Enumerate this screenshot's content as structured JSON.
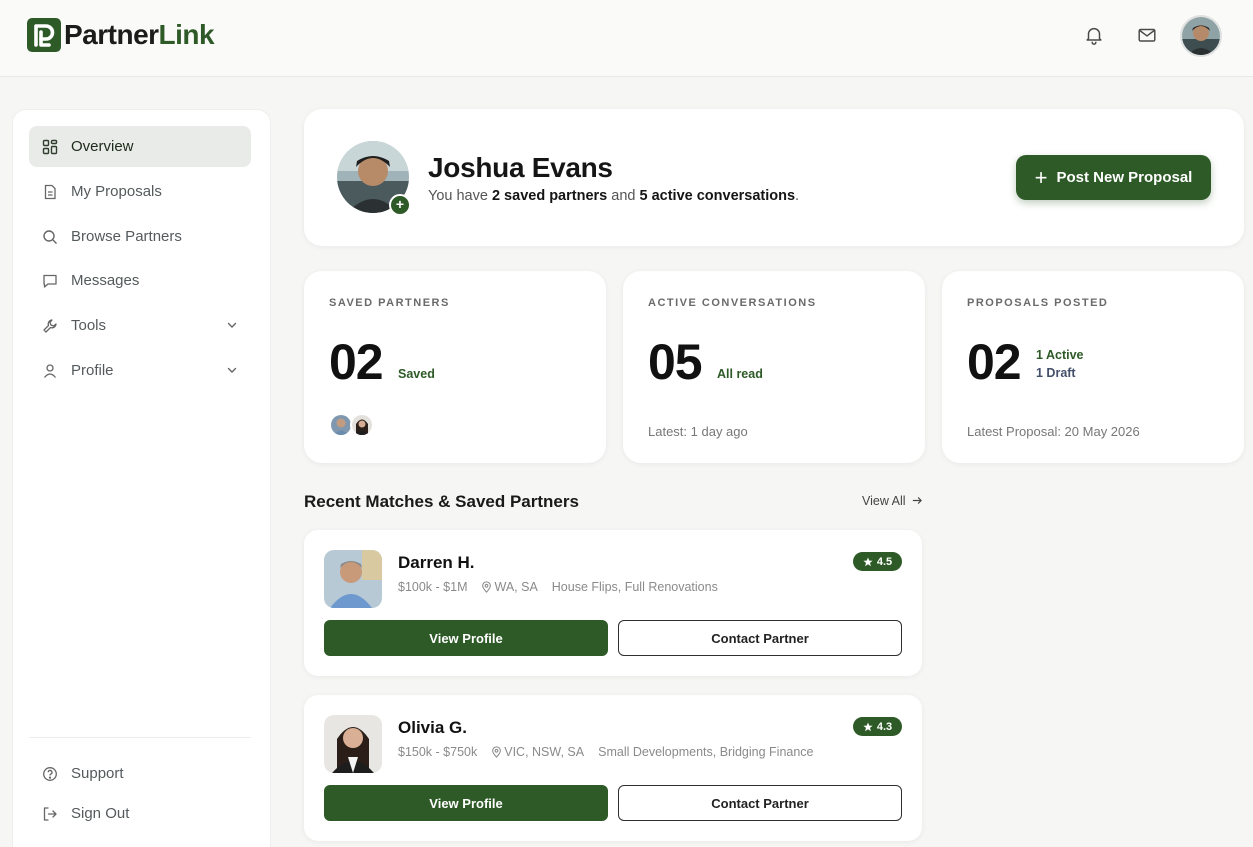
{
  "app": {
    "brand_part1": "Partner",
    "brand_part2": "Link",
    "accent": "#2e5a27"
  },
  "topbar": {
    "icons": [
      "bell-icon",
      "mail-icon"
    ]
  },
  "sidebar": {
    "items": [
      {
        "label": "Overview",
        "icon": "grid-icon",
        "active": true
      },
      {
        "label": "My Proposals",
        "icon": "document-icon"
      },
      {
        "label": "Browse Partners",
        "icon": "search-icon"
      },
      {
        "label": "Messages",
        "icon": "chat-icon"
      },
      {
        "label": "Tools",
        "icon": "wrench-icon",
        "expandable": true
      },
      {
        "label": "Profile",
        "icon": "user-icon",
        "expandable": true
      }
    ],
    "footer": [
      {
        "label": "Support",
        "icon": "help-icon"
      },
      {
        "label": "Sign Out",
        "icon": "sign-out-icon"
      }
    ]
  },
  "welcome": {
    "name": "Joshua Evans",
    "sub_prefix": "You have ",
    "saved_count": "2 saved partners",
    "sub_mid": " and ",
    "conv_count": "5 active conversations",
    "sub_suffix": ".",
    "post_button": "Post New Proposal"
  },
  "stats": [
    {
      "label": "SAVED PARTNERS",
      "value": "02",
      "unit": "Saved"
    },
    {
      "label": "ACTIVE CONVERSATIONS",
      "value": "05",
      "unit": "All read",
      "footer": "Latest: 1 day ago"
    },
    {
      "label": "PROPOSALS POSTED",
      "value": "02",
      "unit1": "1 Active",
      "unit2": "1 Draft",
      "footer": "Latest Proposal: 20 May 2026"
    }
  ],
  "matches_section": {
    "title": "Recent Matches & Saved Partners",
    "view_all": "View All"
  },
  "matches": [
    {
      "name": "Darren H.",
      "budget": "$100k - $1M",
      "location": "WA, SA",
      "focus": "House Flips, Full Renovations",
      "rating": "4.5",
      "view_btn": "View Profile",
      "contact_btn": "Contact Partner"
    },
    {
      "name": "Olivia G.",
      "budget": "$150k - $750k",
      "location": "VIC, NSW, SA",
      "focus": "Small Developments, Bridging Finance",
      "rating": "4.3",
      "view_btn": "View Profile",
      "contact_btn": "Contact Partner"
    }
  ]
}
